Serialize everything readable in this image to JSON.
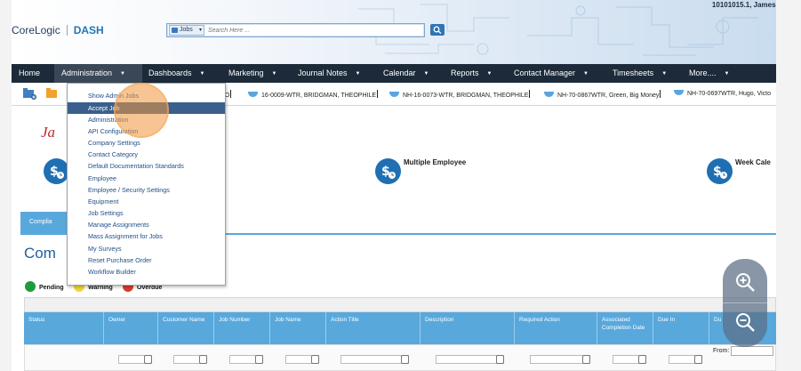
{
  "header": {
    "user": "10101015.1, James I",
    "logo_brand": "CoreLogic",
    "logo_product": "DASH",
    "search_scope": "Jobs",
    "search_placeholder": "Search Here ..."
  },
  "nav": [
    {
      "label": "Home"
    },
    {
      "label": "Administration",
      "active": true
    },
    {
      "label": "Dashboards"
    },
    {
      "label": "Marketing"
    },
    {
      "label": "Journal Notes"
    },
    {
      "label": "Calendar"
    },
    {
      "label": "Reports"
    },
    {
      "label": "Contact Manager"
    },
    {
      "label": "Timesheets"
    },
    {
      "label": "More...."
    }
  ],
  "job_tabs": [
    {
      "label": ", KUNTO"
    },
    {
      "label": "16-0009-WTR, BRIDGMAN, THEOPHILE"
    },
    {
      "label": "NH-16-0073-WTR, BRIDGMAN, THEOPHILE"
    },
    {
      "label": "NH-70-0867WTR, Green, Big Money"
    },
    {
      "label": "NH-70-0697WTR, Hugo, Victo"
    }
  ],
  "admin_menu": [
    "Show Admin Jobs",
    "Accept Job",
    "Administration",
    "API Configuration",
    "Company Settings",
    "Contact Category",
    "Default Documentation Standards",
    "Employee",
    "Employee / Security Settings",
    "Equipment",
    "Job Settings",
    "Manage Assignments",
    "Mass Assignment for Jobs",
    "My Surveys",
    "Reset Purchase Order",
    "Workflow Builder"
  ],
  "admin_menu_highlighted": 1,
  "page": {
    "title": "Ja",
    "card_multiple_employee": "Multiple Employee",
    "card_week_calendar": "Week Cale",
    "compliance_tab": "Complia",
    "section_title": "Com"
  },
  "legend": [
    {
      "label": "Pending",
      "color": "#1e9b3a"
    },
    {
      "label": "Warning",
      "color": "#f2d43a"
    },
    {
      "label": "Overdue",
      "color": "#d93b2f"
    }
  ],
  "table": {
    "columns": [
      "Status",
      "Owner",
      "Customer Name",
      "Job Number",
      "Job Name",
      "Action Title",
      "Description",
      "Required Action",
      "Associated Completion Date",
      "Due In",
      "Du"
    ],
    "from_label": "From:"
  }
}
